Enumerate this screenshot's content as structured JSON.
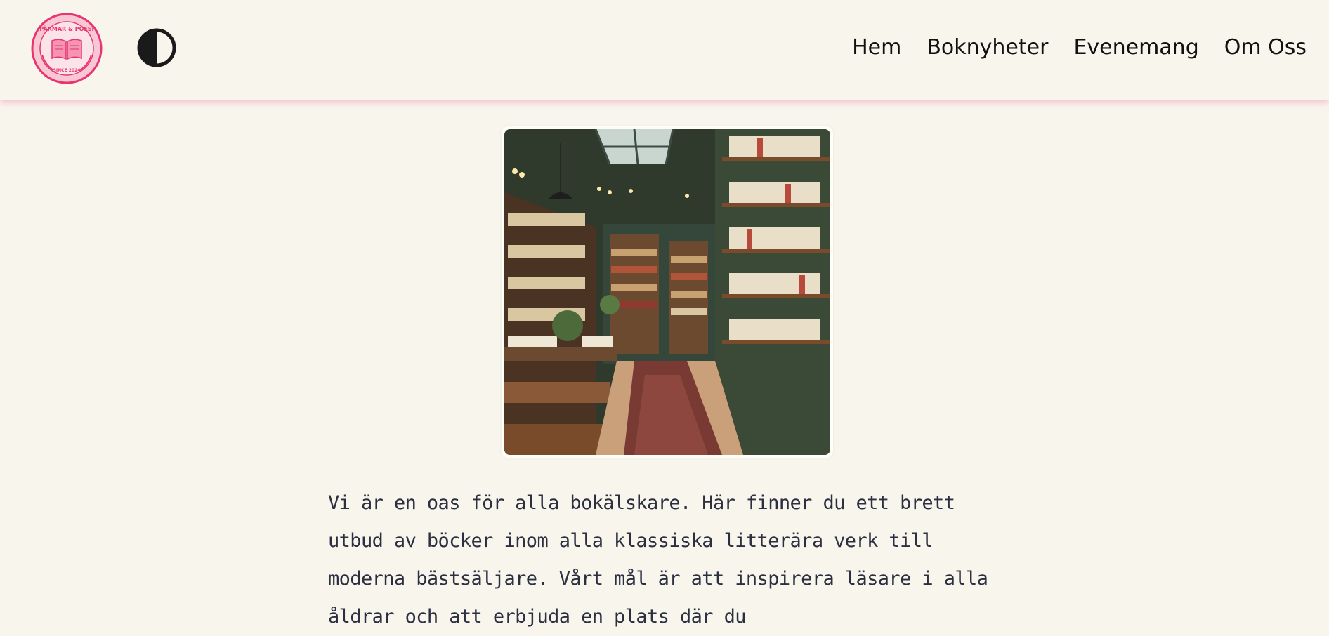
{
  "header": {
    "logo": {
      "icon": "open-book-badge",
      "text_top": "PÄRMAR & POESI",
      "text_bottom": "SINCE 2024"
    },
    "theme_toggle": {
      "icon": "half-circle-contrast-icon"
    },
    "nav": [
      {
        "label": "Hem"
      },
      {
        "label": "Boknyheter"
      },
      {
        "label": "Evenemang"
      },
      {
        "label": "Om Oss"
      }
    ]
  },
  "main": {
    "hero_image": {
      "subject": "bookstore interior"
    },
    "intro_text": "Vi är en oas för alla bokälskare. Här finner du ett brett utbud av böcker inom alla klassiska litterära verk till moderna bästsäljare. Vårt mål är att inspirera läsare i alla åldrar och att erbjuda en plats där du"
  },
  "colors": {
    "background": "#f8f5ec",
    "header_shadow": "#f096b4",
    "logo_pink": "#e8356e",
    "text": "#2b2f3f"
  }
}
